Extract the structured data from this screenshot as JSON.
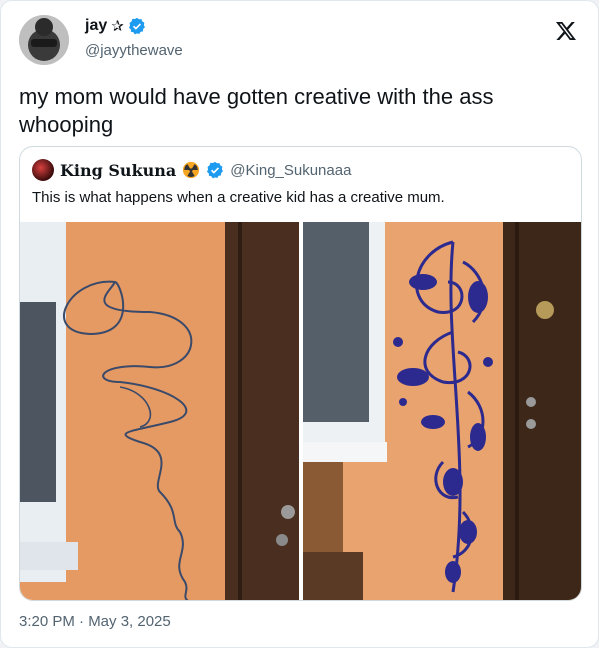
{
  "author": {
    "display_name": "jay",
    "name_suffix": "✰",
    "handle": "@jayythewave",
    "verified": true,
    "avatar_icon": "profile-photo-icon"
  },
  "brand_icon": "x-logo-icon",
  "tweet": {
    "text": "my mom would have gotten creative with the ass whooping"
  },
  "quoted": {
    "display_name": "King Sukuna",
    "handle": "@King_Sukunaaa",
    "text": "This is what happens when a creative kid has a creative mum.",
    "badge_icon": "radioactive-icon",
    "verified": true,
    "media": [
      {
        "icon": "photo-scribbled-wall-icon"
      },
      {
        "icon": "photo-painted-floral-wall-icon"
      }
    ]
  },
  "timestamp": "3:20 PM · May 3, 2025",
  "colors": {
    "verified_blue": "#1d9bf0",
    "badge_orange": "#f5a623",
    "wall_orange": "#e9a16b",
    "door_brown": "#4a2e1f",
    "paint_blue": "#2c2a8f"
  }
}
